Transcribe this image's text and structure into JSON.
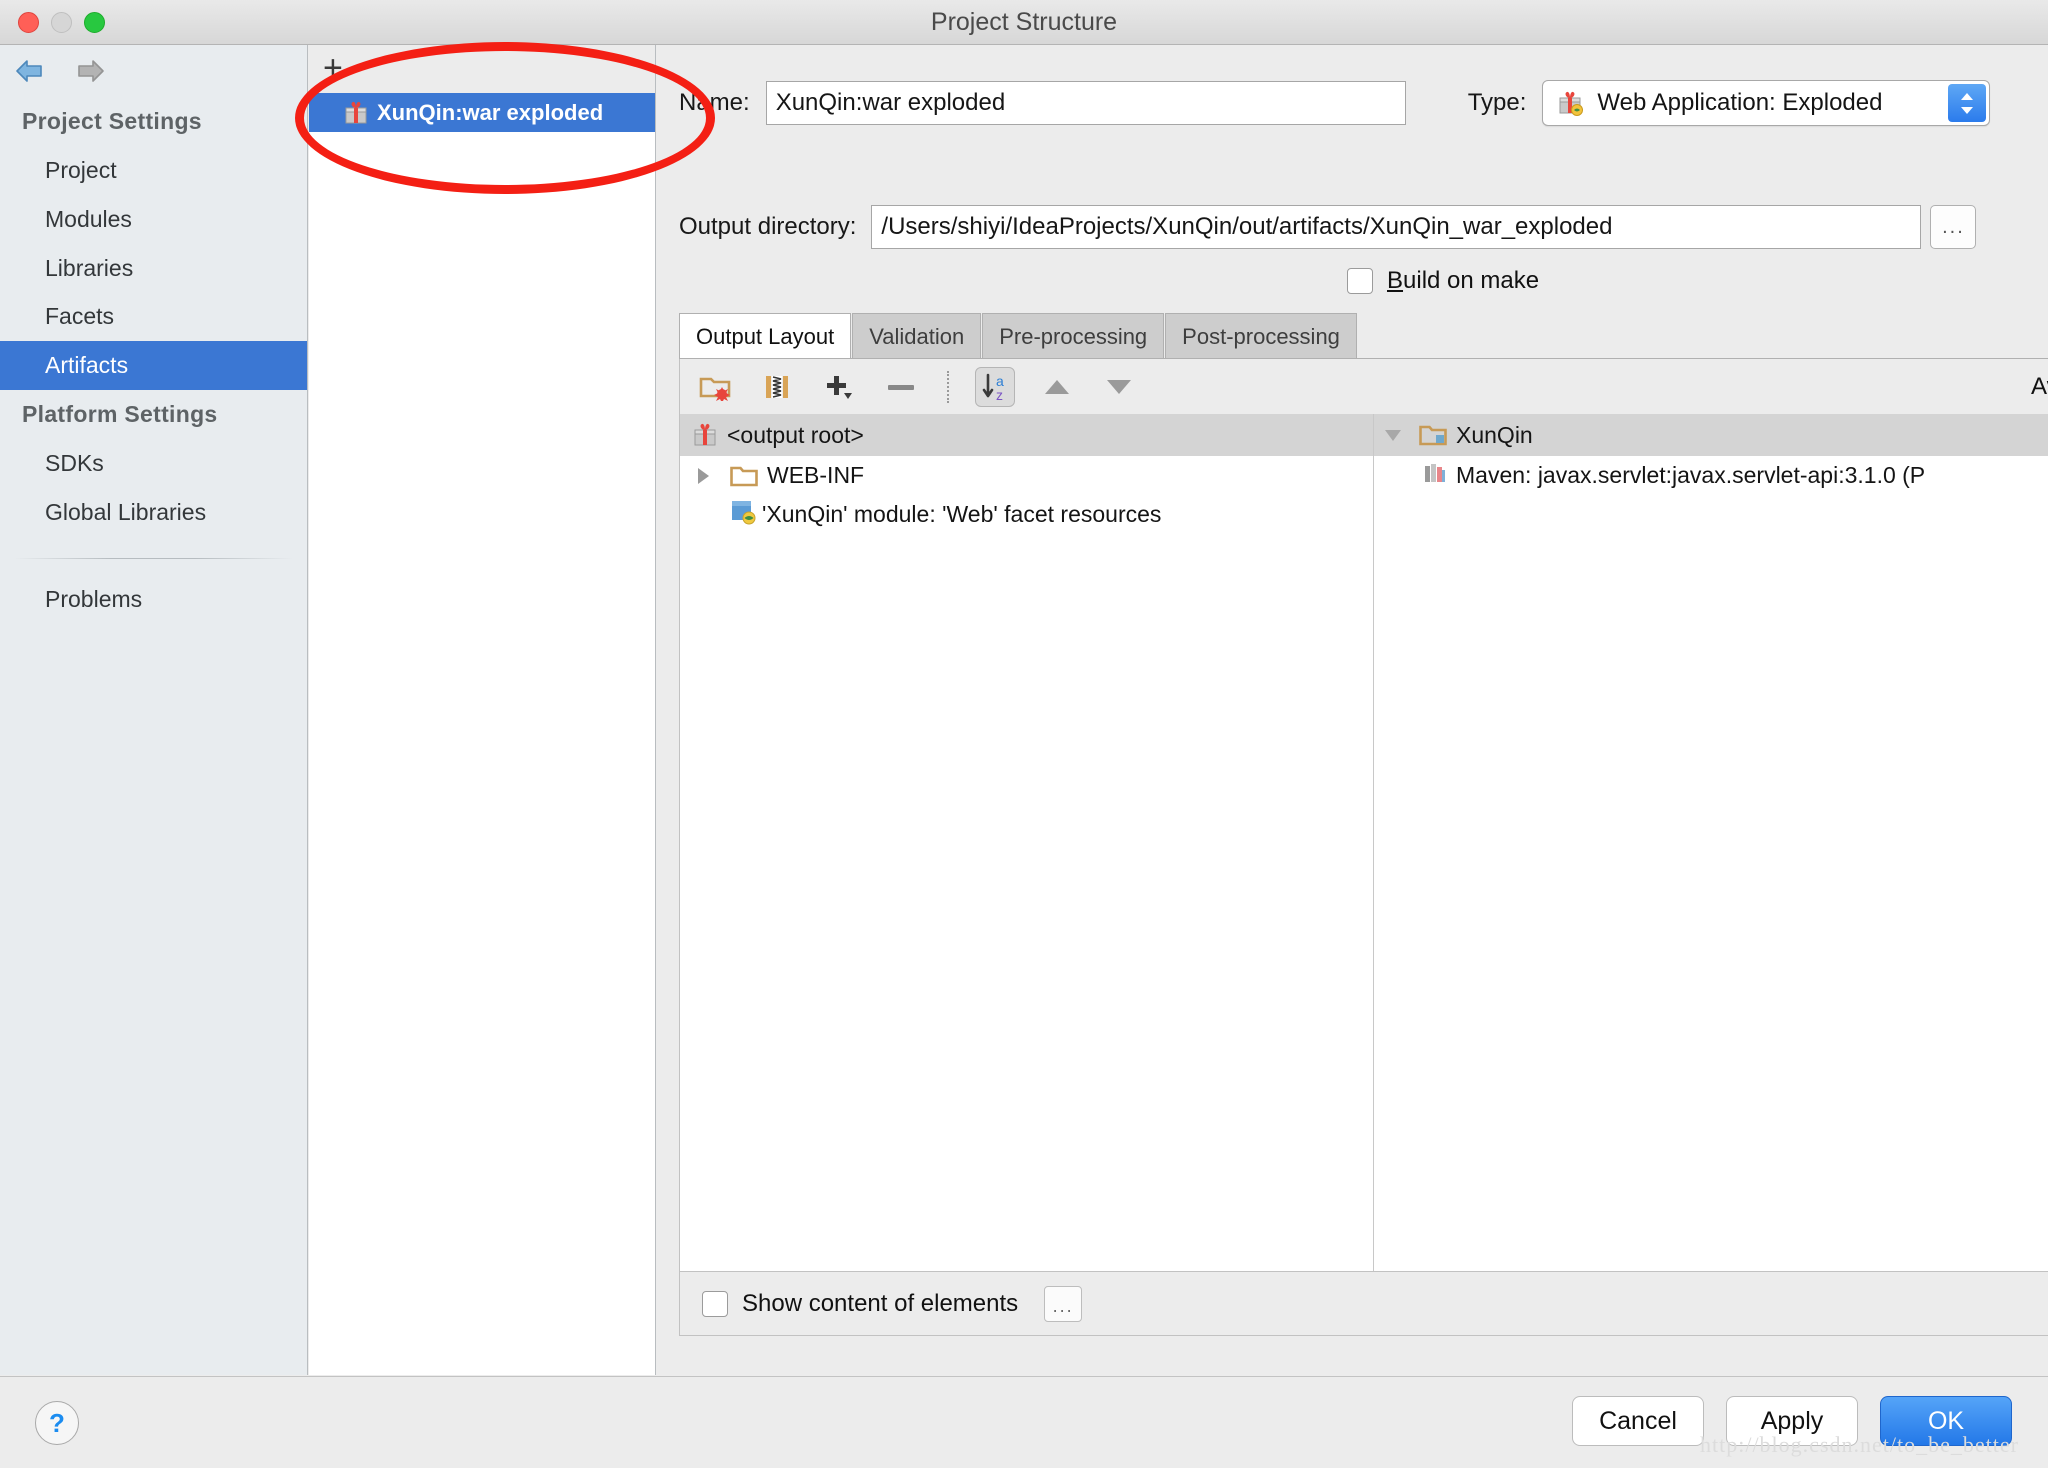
{
  "window": {
    "title": "Project Structure",
    "traffic_lights": [
      "close-red",
      "minimize-yellow",
      "zoom-green"
    ]
  },
  "nav": {
    "back_icon": "arrow-left-icon",
    "forward_icon": "arrow-right-icon"
  },
  "sidebar": {
    "sections": [
      {
        "label": "Project Settings",
        "items": [
          {
            "label": "Project",
            "selected": false
          },
          {
            "label": "Modules",
            "selected": false
          },
          {
            "label": "Libraries",
            "selected": false
          },
          {
            "label": "Facets",
            "selected": false
          },
          {
            "label": "Artifacts",
            "selected": true
          }
        ]
      },
      {
        "label": "Platform Settings",
        "items": [
          {
            "label": "SDKs",
            "selected": false
          },
          {
            "label": "Global Libraries",
            "selected": false
          }
        ]
      }
    ],
    "problems_label": "Problems",
    "selected_color": "#3b77d3"
  },
  "artifacts_panel": {
    "add_button_label": "+",
    "items": [
      {
        "label": "XunQin:war exploded",
        "icon": "artifact-gift-icon",
        "selected": true
      }
    ]
  },
  "detail": {
    "name_label": "Name:",
    "name_value": "XunQin:war exploded",
    "type_label": "Type:",
    "type_value": "Web Application: Exploded",
    "type_icon": "artifact-gift-icon",
    "output_dir_label": "Output directory:",
    "output_dir_value": "/Users/shiyi/IdeaProjects/XunQin/out/artifacts/XunQin_war_exploded",
    "browse_button_label": "...",
    "build_on_make": {
      "label_prefix": "B",
      "label_rest": "uild on make",
      "checked": false
    },
    "tabs": [
      {
        "label": "Output Layout",
        "active": true
      },
      {
        "label": "Validation",
        "active": false
      },
      {
        "label": "Pre-processing",
        "active": false
      },
      {
        "label": "Post-processing",
        "active": false
      }
    ]
  },
  "layout_toolbar": {
    "buttons": [
      {
        "name": "create-directory-icon",
        "label": ""
      },
      {
        "name": "create-archive-icon",
        "label": ""
      },
      {
        "name": "add-dropdown-icon",
        "label": ""
      },
      {
        "name": "remove-icon",
        "label": ""
      },
      {
        "name": "sort-alphabetically-icon",
        "label": "",
        "pressed": true
      },
      {
        "name": "move-up-icon",
        "label": ""
      },
      {
        "name": "move-down-icon",
        "label": ""
      }
    ]
  },
  "output_tree": {
    "root": {
      "label": "<output root>",
      "icon": "artifact-gift-icon"
    },
    "rows": [
      {
        "label": "WEB-INF",
        "icon": "folder-icon",
        "expandable": true,
        "expanded": false,
        "indent": 0
      },
      {
        "label": "'XunQin' module: 'Web' facet resources",
        "icon": "web-module-icon",
        "expandable": false,
        "indent": 1
      }
    ]
  },
  "available_elements": {
    "title": "Available Elements",
    "help_icon": "question-mark-icon",
    "rows": [
      {
        "label": "XunQin",
        "icon": "module-folder-icon",
        "expandable": true,
        "expanded": true,
        "indent": 0
      },
      {
        "label": "Maven: javax.servlet:javax.servlet-api:3.1.0 (P",
        "icon": "library-icon",
        "expandable": false,
        "indent": 1
      }
    ]
  },
  "bottom_strip": {
    "show_content_label": "Show content of elements",
    "show_content_checked": false,
    "more_button_label": "..."
  },
  "footer": {
    "help_label": "?",
    "buttons": [
      {
        "label": "Cancel",
        "style": "plain"
      },
      {
        "label": "Apply",
        "style": "plain"
      },
      {
        "label": "OK",
        "style": "primary"
      }
    ]
  },
  "watermark": "http://blog.csdn.net/to_be_better",
  "annotation": {
    "type": "ellipse",
    "color": "#f41f14",
    "target": "XunQin:war exploded"
  }
}
